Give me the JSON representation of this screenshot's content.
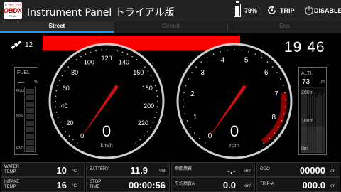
{
  "header": {
    "logo_top": "トライアル版",
    "logo_brand": "OBDX",
    "logo_bottom": "TRIAL",
    "title": "Instrument Panel トライアル版",
    "battery_pct": "79%",
    "trip_label": "TRIP",
    "disable_label": "DISABLE",
    "icons": [
      "battery-icon",
      "trip-reset-icon",
      "power-icon"
    ]
  },
  "tabs": [
    {
      "label": "Street",
      "active": true
    },
    {
      "label": "Circuit",
      "active": false
    },
    {
      "label": "Eco",
      "active": false
    }
  ],
  "status": {
    "satellites": "12",
    "clock": "19 46",
    "alert_color": "#ff0000"
  },
  "fuel": {
    "title": "FUEL",
    "value": "---",
    "unit": "%",
    "labels": [
      "FULL",
      "50%",
      "END"
    ]
  },
  "speedometer": {
    "value": "0",
    "unit": "km/h",
    "ticks": [
      "0",
      "20",
      "40",
      "60",
      "80",
      "100",
      "120",
      "140",
      "160",
      "180",
      "200",
      "220"
    ],
    "min": 0,
    "max": 240,
    "needle_value": 0
  },
  "tachometer": {
    "value": "0",
    "unit": "rpm",
    "ticks": [
      "0",
      "1",
      "2",
      "3",
      "4",
      "5",
      "6",
      "7",
      "8"
    ],
    "min": 0,
    "max": 9,
    "redline_from": 7,
    "needle_value": 0
  },
  "altitude": {
    "title": "ALTI.",
    "value": "73",
    "unit": "m",
    "labels": [
      "200m",
      "100m",
      "0m"
    ]
  },
  "readings": {
    "water_temp": {
      "label_line1": "WATER",
      "label_line2": "TEMP.",
      "value": "10",
      "unit": "°C"
    },
    "intake_temp": {
      "label_line1": "INTAKE",
      "label_line2": "TEMP.",
      "value": "16",
      "unit": "°C"
    },
    "battery": {
      "label_line1": "BATTERY",
      "label_line2": "",
      "value": "11.9",
      "unit": "Volt"
    },
    "stop_time": {
      "label_line1": "STOP",
      "label_line2": "TIME",
      "value": "00:00:56",
      "unit": ""
    },
    "instant_fuel": {
      "label_line1": "瞬間燃費",
      "label_line2": "",
      "value": "-.-",
      "unit": "km/l"
    },
    "avg_fuel": {
      "label_line1": "平均燃費A",
      "label_line2": "",
      "value": "0.0",
      "unit": "km/l"
    },
    "odo": {
      "label_line1": "ODO",
      "label_line2": "",
      "value": "00000",
      "unit": "km"
    },
    "trip_a": {
      "label_line1": "TRIP-A",
      "label_line2": "",
      "value": "000.0",
      "unit": "km"
    }
  },
  "colors": {
    "accent": "#2196f3",
    "needle": "#d01010",
    "redzone": "#8b0000"
  }
}
